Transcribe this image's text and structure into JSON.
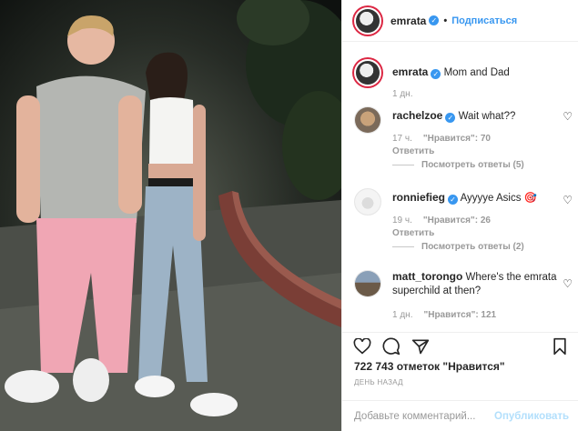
{
  "header": {
    "username": "emrata",
    "follow_label": "Подписаться",
    "dot": "•"
  },
  "caption": {
    "username": "emrata",
    "text": "Mom and Dad",
    "time": "1 дн."
  },
  "comments": [
    {
      "username": "rachelzoe",
      "text": "Wait what??",
      "time": "17 ч.",
      "likes": "\"Нравится\": 70",
      "reply": "Ответить",
      "thread": "Посмотреть ответы (5)"
    },
    {
      "username": "ronniefieg",
      "text": "Ayyyye Asics",
      "emoji": "🎯",
      "time": "19 ч.",
      "likes": "\"Нравится\": 26",
      "reply": "Ответить",
      "thread": "Посмотреть ответы (2)"
    },
    {
      "username": "matt_torongo",
      "text": "Where's the emrata superchild at then?",
      "time": "1 дн.",
      "likes": "\"Нравится\": 121"
    }
  ],
  "stats": {
    "likes": "722 743 отметок \"Нравится\"",
    "posted": "ДЕНЬ НАЗАД"
  },
  "add_comment": {
    "placeholder": "Добавьте комментарий...",
    "publish_label": "Опубликовать"
  },
  "icons": {
    "like": "heart-icon",
    "comment": "comment-icon",
    "share": "share-icon",
    "save": "bookmark-icon",
    "verified": "verified-badge-icon"
  },
  "colors": {
    "accent": "#3897f0",
    "muted": "#999999",
    "publish_disabled": "#b2dffc"
  }
}
